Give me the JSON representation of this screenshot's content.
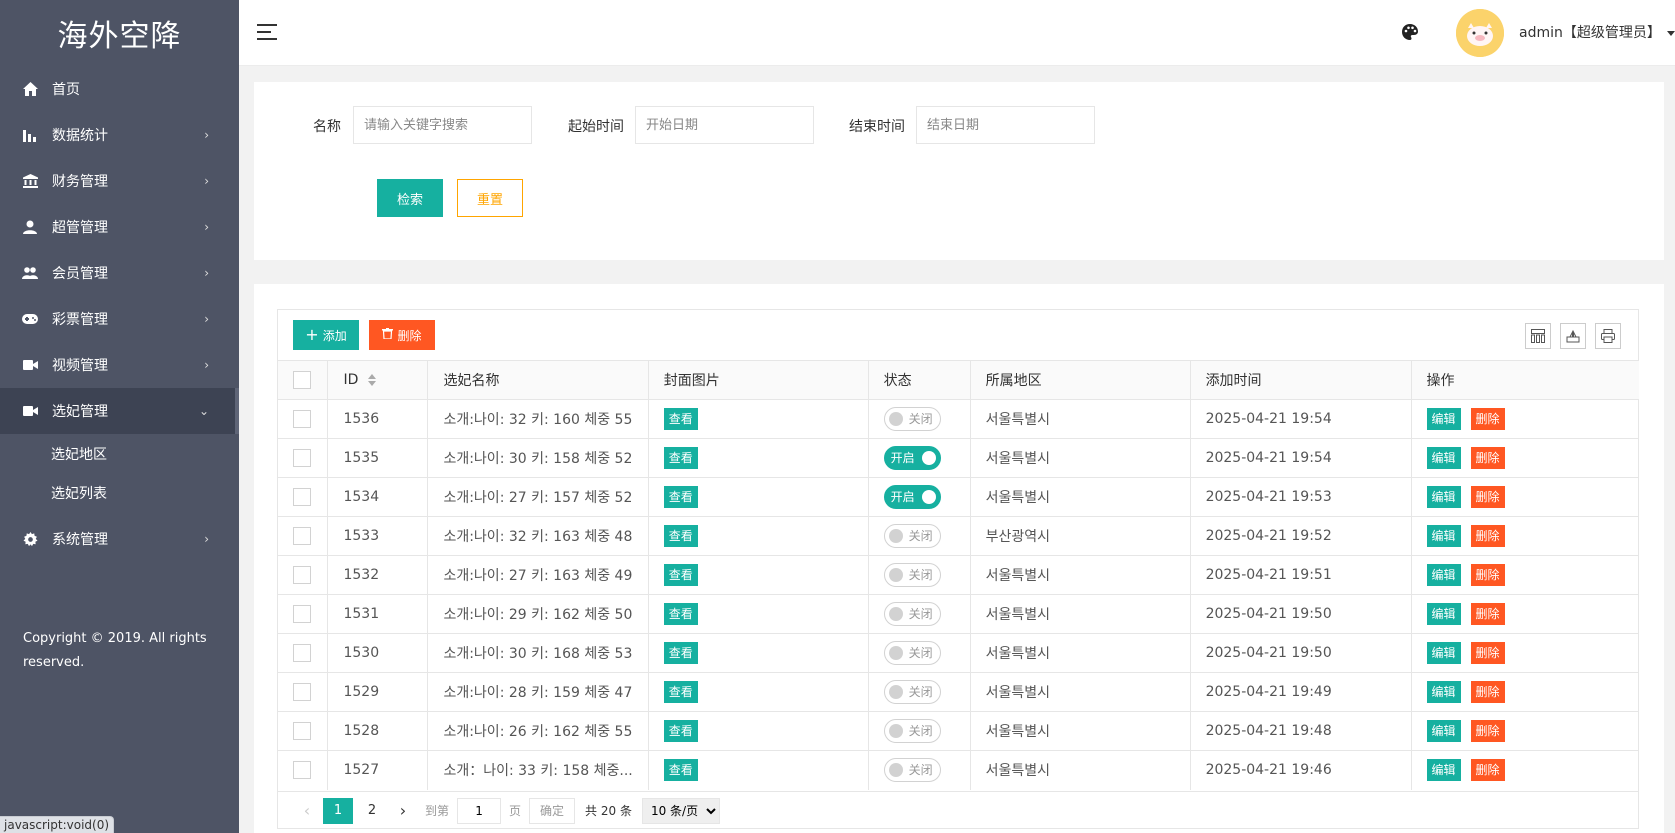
{
  "sidebar": {
    "logo": "海外空降",
    "items": [
      {
        "label": "首页",
        "icon": "home-icon"
      },
      {
        "label": "数据统计",
        "icon": "bar-chart-icon"
      },
      {
        "label": "财务管理",
        "icon": "bank-icon"
      },
      {
        "label": "超管管理",
        "icon": "user-icon"
      },
      {
        "label": "会员管理",
        "icon": "users-icon"
      },
      {
        "label": "彩票管理",
        "icon": "gamepad-icon"
      },
      {
        "label": "视频管理",
        "icon": "video-icon"
      },
      {
        "label": "选妃管理",
        "icon": "video-icon"
      },
      {
        "label": "系统管理",
        "icon": "gear-icon"
      }
    ],
    "sub_items": [
      "选妃地区",
      "选妃列表"
    ],
    "copyright": "Copyright © 2019. All rights reserved.",
    "status_url": "javascript:void(0)"
  },
  "header": {
    "user": "admin【超级管理员】",
    "avatar_color": "#fbd36b"
  },
  "search": {
    "name_label": "名称",
    "name_placeholder": "请输入关键字搜索",
    "start_label": "起始时间",
    "start_placeholder": "开始日期",
    "end_label": "结束时间",
    "end_placeholder": "结束日期",
    "search_button": "检索",
    "reset_button": "重置"
  },
  "toolbar": {
    "add_label": "添加",
    "delete_label": "删除"
  },
  "table": {
    "columns": [
      "ID",
      "选妃名称",
      "封面图片",
      "状态",
      "所属地区",
      "添加时间",
      "操作"
    ],
    "view_label": "查看",
    "edit_label": "编辑",
    "remove_label": "删除",
    "switch_on": "开启",
    "switch_off": "关闭",
    "rows": [
      {
        "id": "1536",
        "name": "소개:나이: 32 키: 160 체중 55",
        "on": false,
        "region": "서울특별시",
        "time": "2025-04-21 19:54"
      },
      {
        "id": "1535",
        "name": "소개:나이: 30 키: 158 체중 52",
        "on": true,
        "region": "서울특별시",
        "time": "2025-04-21 19:54"
      },
      {
        "id": "1534",
        "name": "소개:나이: 27 키: 157 체중 52",
        "on": true,
        "region": "서울특별시",
        "time": "2025-04-21 19:53"
      },
      {
        "id": "1533",
        "name": "소개:나이: 32 키: 163 체중 48",
        "on": false,
        "region": "부산광역시",
        "time": "2025-04-21 19:52"
      },
      {
        "id": "1532",
        "name": "소개:나이: 27 키: 163 체중 49",
        "on": false,
        "region": "서울특별시",
        "time": "2025-04-21 19:51"
      },
      {
        "id": "1531",
        "name": "소개:나이: 29 키: 162 체중 50",
        "on": false,
        "region": "서울특별시",
        "time": "2025-04-21 19:50"
      },
      {
        "id": "1530",
        "name": "소개:나이: 30 키: 168 체중 53",
        "on": false,
        "region": "서울특별시",
        "time": "2025-04-21 19:50"
      },
      {
        "id": "1529",
        "name": "소개:나이: 28 키: 159 체중 47",
        "on": false,
        "region": "서울특별시",
        "time": "2025-04-21 19:49"
      },
      {
        "id": "1528",
        "name": "소개:나이: 26 키: 162 체중 55",
        "on": false,
        "region": "서울특별시",
        "time": "2025-04-21 19:48"
      },
      {
        "id": "1527",
        "name": "소개：나이: 33 키: 158 체중...",
        "on": false,
        "region": "서울특별시",
        "time": "2025-04-21 19:46"
      }
    ]
  },
  "pagination": {
    "pages": [
      "1",
      "2"
    ],
    "current": "1",
    "goto_prefix": "到第",
    "goto_value": "1",
    "goto_suffix": "页",
    "confirm": "确定",
    "total": "共 20 条",
    "page_size": "10 条/页"
  },
  "colors": {
    "primary": "#16b0a0",
    "danger": "#ff5722",
    "warning": "#ffa500",
    "sidebar": "#4e5465"
  }
}
